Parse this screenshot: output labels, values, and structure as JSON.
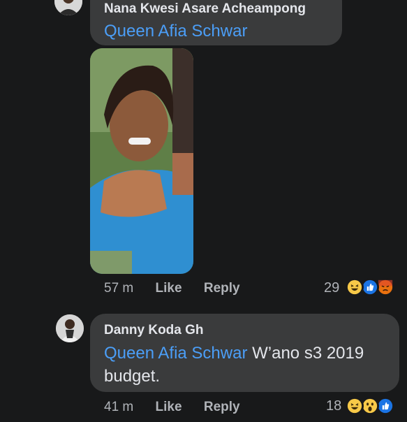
{
  "comments": [
    {
      "author": "Nana Kwesi Asare Acheampong",
      "mention": "Queen Afia Schwar",
      "text": "",
      "time": "57 m",
      "like": "Like",
      "reply": "Reply",
      "reaction_count": "29",
      "reactions": [
        "haha-icon",
        "like-icon",
        "angry-icon"
      ]
    },
    {
      "author": "Danny Koda Gh",
      "mention": "Queen Afia Schwar",
      "text": " W’ano s3 2019 budget.",
      "time": "41 m",
      "like": "Like",
      "reply": "Reply",
      "reaction_count": "18",
      "reactions": [
        "haha-icon",
        "wow-icon",
        "like-icon"
      ]
    }
  ],
  "colors": {
    "background": "#18191a",
    "bubble": "#3a3b3c",
    "mention": "#4b9ef7",
    "meta": "#b0b3b8"
  }
}
